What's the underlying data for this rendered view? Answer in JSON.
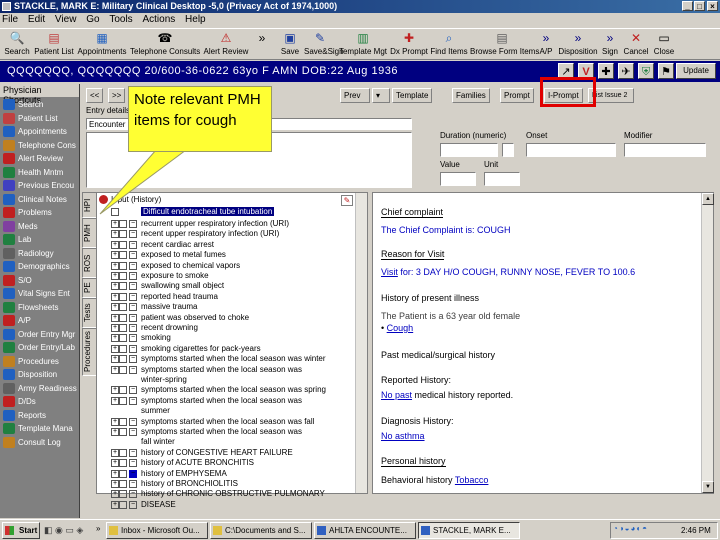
{
  "window": {
    "title": "STACKLE, MARK E: Military Clinical Desktop -5,0 (Privacy Act of 1974,1000)"
  },
  "menu": [
    "File",
    "Edit",
    "View",
    "Go",
    "Tools",
    "Actions",
    "Help"
  ],
  "toolbar": [
    "Search",
    "Patient List",
    "Appointments",
    "Telephone Consults",
    "Alert Review",
    "Save",
    "Save&Sign",
    "Template Mgt",
    "Dx Prompt",
    "Find Items",
    "Browse Form Items",
    "A/P",
    "Disposition",
    "Sign",
    "Cancel",
    "Close"
  ],
  "patient": {
    "banner": "QQQQQQQ, QQQQQQQ  20/600-36-0622  63yo  F   AMN  DOB:22 Aug 1936",
    "update_label": "Update"
  },
  "sidebar": {
    "header": "Physician Shortcuts",
    "items": [
      {
        "label": "Search",
        "icon": "search-icon",
        "color": "#2060c0"
      },
      {
        "label": "Patient List",
        "icon": "patient-list-icon",
        "color": "#c04040"
      },
      {
        "label": "Appointments",
        "icon": "appointments-icon",
        "color": "#2060c0"
      },
      {
        "label": "Telephone Cons",
        "icon": "telephone-icon",
        "color": "#c08020"
      },
      {
        "label": "Alert Review",
        "icon": "alert-icon",
        "color": "#c02020"
      },
      {
        "label": "Health Mntm",
        "icon": "health-icon",
        "color": "#208040"
      },
      {
        "label": "Previous Encou",
        "icon": "previous-encounter-icon",
        "color": "#4040c0"
      },
      {
        "label": "Clinical Notes",
        "icon": "clinical-notes-icon",
        "color": "#2060c0"
      },
      {
        "label": "Problems",
        "icon": "problems-icon",
        "color": "#c02020"
      },
      {
        "label": "Meds",
        "icon": "meds-icon",
        "color": "#8040a0"
      },
      {
        "label": "Lab",
        "icon": "lab-icon",
        "color": "#208040"
      },
      {
        "label": "Radiology",
        "icon": "radiology-icon",
        "color": "#606060"
      },
      {
        "label": "Demographics",
        "icon": "demographics-icon",
        "color": "#2060c0"
      },
      {
        "label": "S/O",
        "icon": "subjective-objective-icon",
        "color": "#c02020"
      },
      {
        "label": "Vital Signs Ent",
        "icon": "vital-signs-icon",
        "color": "#2060c0"
      },
      {
        "label": "Flowsheets",
        "icon": "flowsheets-icon",
        "color": "#208040"
      },
      {
        "label": "A/P",
        "icon": "assessment-plan-icon",
        "color": "#c02020"
      },
      {
        "label": "Order Entry Mgr",
        "icon": "order-entry-icon",
        "color": "#2060c0"
      },
      {
        "label": "Order Entry/Lab",
        "icon": "order-lab-icon",
        "color": "#208040"
      },
      {
        "label": "Procedures",
        "icon": "procedures-icon",
        "color": "#c08020"
      },
      {
        "label": "Disposition",
        "icon": "disposition-icon",
        "color": "#2060c0"
      },
      {
        "label": "Army Readiness",
        "icon": "readiness-icon",
        "color": "#606060"
      },
      {
        "label": "D/Ds",
        "icon": "dds-icon",
        "color": "#c02020"
      },
      {
        "label": "Reports",
        "icon": "reports-icon",
        "color": "#2060c0"
      },
      {
        "label": "Template Mana",
        "icon": "template-icon",
        "color": "#208040"
      },
      {
        "label": "Consult Log",
        "icon": "consult-log-icon",
        "color": "#c08020"
      }
    ]
  },
  "nav": {
    "back": "<<",
    "back2": ">>",
    "prev_label": "Prev",
    "tabs": [
      "Template",
      "Families",
      "Prompt",
      "I-Prompt",
      "List Issue 2"
    ]
  },
  "form": {
    "entry_label": "Entry details",
    "encounter_label": "Encounter",
    "duration_label": "Duration (numeric)",
    "onset_label": "Onset",
    "modifier_label": "Modifier",
    "value_label": "Value",
    "unit_label": "Unit"
  },
  "vtabs": [
    "HPI",
    "PMH",
    "ROS",
    "PE",
    "Tests",
    "Procedures"
  ],
  "tree": {
    "root": "Input (History)",
    "selected": "Difficult endotracheal tube intubation",
    "items": [
      "recurrent upper respiratory infection (URI)",
      "recent upper respiratory infection (URI)",
      "recent cardiac arrest",
      "exposed to metal fumes",
      "exposed to chemical vapors",
      "exposure to smoke",
      "swallowing small object",
      "reported head trauma",
      "massive trauma",
      "patient was observed to choke",
      "recent drowning",
      "smoking",
      "smoking cigarettes for         pack-years",
      "symptoms started when the local season was winter",
      "symptoms started when the local season was",
      "symptoms started when the local season was spring",
      "symptoms started when the local season was",
      "symptoms started when the local season was fall",
      "symptoms started when the local season was",
      "history of CONGESTIVE HEART FAILURE",
      "history of ACUTE BRONCHITIS",
      "history of EMPHYSEMA",
      "history of BRONCHIOLITIS",
      "history of CHRONIC OBSTRUCTIVE PULMONARY",
      "DISEASE"
    ],
    "continuations": {
      "14": "winter-spring",
      "16": "summer",
      "18": "fall winter"
    }
  },
  "note": {
    "chief_heading": "Chief complaint",
    "chief_text": "The Chief Complaint is: COUGH",
    "reason_heading": "Reason for Visit",
    "reason_link": "Visit",
    "reason_text": "for: 3 DAY H/O COUGH, RUNNY NOSE, FEVER TO 100.6",
    "hpi_heading": "History of present illness",
    "hpi_text": "The Patient is a 63 year old female",
    "hpi_bullet": "Cough",
    "pmh_heading": "Past medical/surgical history",
    "reported_heading": "Reported History:",
    "reported_link": "No past",
    "reported_text": "medical history reported.",
    "dx_heading": "Diagnosis History:",
    "dx_link": "No asthma",
    "personal_heading": "Personal history",
    "personal_text": "Behavioral history",
    "personal_link": "Tobacco"
  },
  "callout": {
    "text": "Note relevant PMH items for cough"
  },
  "taskbar": {
    "start": "Start",
    "tasks": [
      "Inbox - Microsoft Ou...",
      "C:\\Documents and S...",
      "AHLTA ENCOUNTE...",
      "STACKLE, MARK E..."
    ],
    "clock": "2:46 PM"
  }
}
